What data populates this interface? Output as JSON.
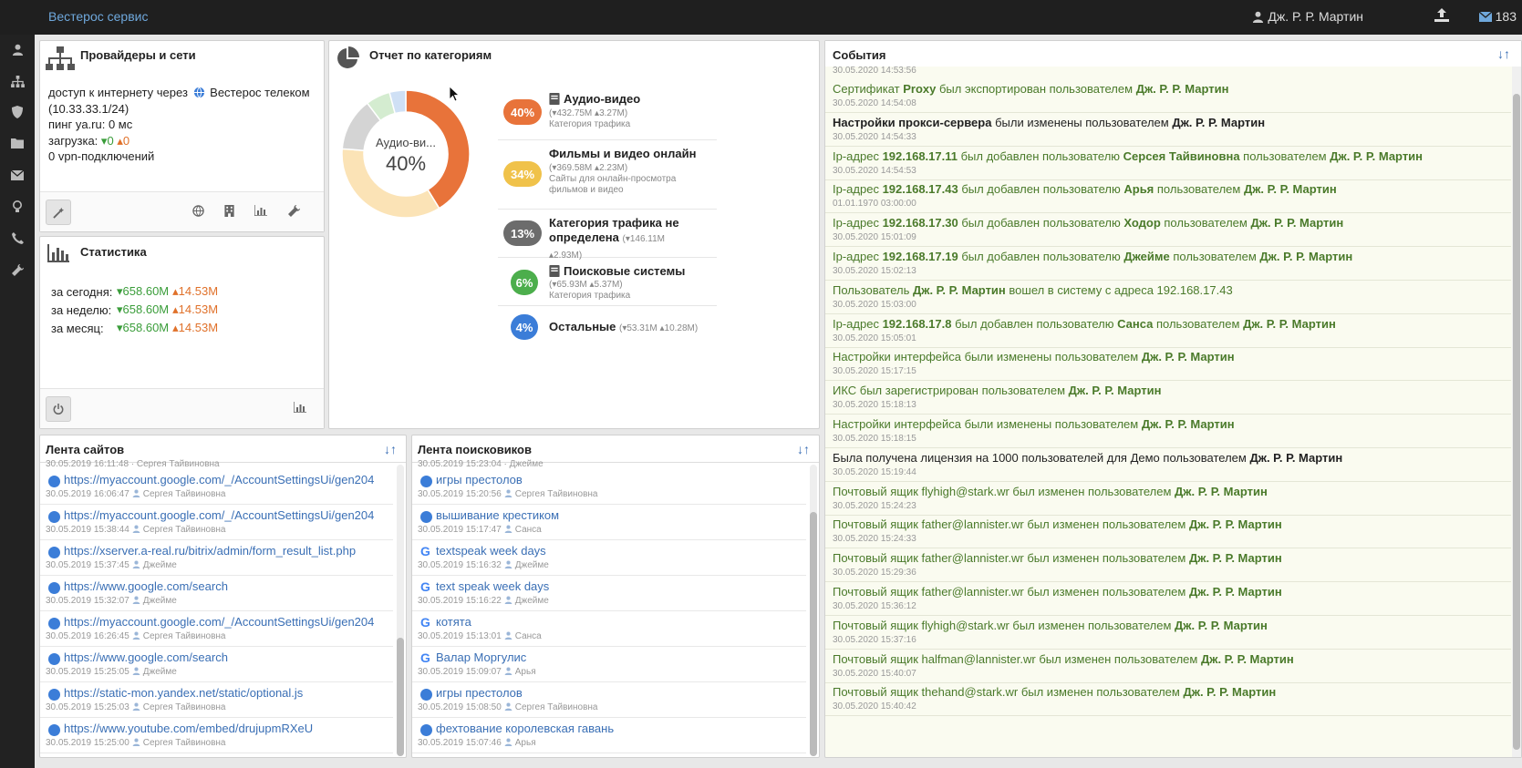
{
  "header": {
    "brand": "Вестерос сервис",
    "user": "Дж. Р. Р. Мартин",
    "mail_count": "183"
  },
  "providers": {
    "title": "Провайдеры и сети",
    "line1_prefix": "доступ к интернету через",
    "provider": "Вестерос телеком",
    "subnet": "(10.33.33.1/24)",
    "ping": "пинг ya.ru: 0 мс",
    "load_label": "загрузка:",
    "load_down": "0",
    "load_up": "0",
    "vpn": "0 vpn-подключений"
  },
  "stats": {
    "title": "Статистика",
    "rows": [
      {
        "label": "за сегодня:",
        "down": "658.60M",
        "up": "14.53M"
      },
      {
        "label": "за неделю:",
        "down": "658.60M",
        "up": "14.53M"
      },
      {
        "label": "за месяц:",
        "down": "658.60M",
        "up": "14.53M"
      }
    ]
  },
  "categories": {
    "title": "Отчет по категориям",
    "donut_label": "Аудио-ви...",
    "donut_value": "40%",
    "chart_data": {
      "type": "pie",
      "values": [
        40,
        34,
        13,
        6,
        4
      ],
      "colors": [
        "#e8733a",
        "#fbe3b6",
        "#d4d4d4",
        "#d4ecd0",
        "#cfe0f5"
      ]
    },
    "items": [
      {
        "pct": "40%",
        "color": "#e8733a",
        "name": "Аудио-видео",
        "stats": "(▾432.75M ▴3.27M)",
        "desc": "Категория трафика"
      },
      {
        "pct": "34%",
        "color": "#f0c24a",
        "name": "Фильмы и видео онлайн",
        "stats": "(▾369.58M ▴2.23M)",
        "desc": "Сайты для онлайн-просмотра фильмов и видео"
      },
      {
        "pct": "13%",
        "color": "#6c6c6c",
        "name": "Категория трафика не определена",
        "stats": "(▾146.11M ▴2.93M)",
        "desc": ""
      },
      {
        "pct": "6%",
        "color": "#4cae4c",
        "name": "Поисковые системы",
        "stats": "(▾65.93M ▴5.37M)",
        "desc": "Категория трафика"
      },
      {
        "pct": "4%",
        "color": "#3b7dd8",
        "name": "Остальные",
        "stats": "(▾53.31M ▴10.28M)",
        "desc": ""
      }
    ]
  },
  "sites": {
    "title": "Лента сайтов",
    "partial_meta": "30.05.2019 16:11:48 · Сергея Тайвиновна",
    "items": [
      {
        "url": "https://myaccount.google.com/_/AccountSettingsUi/gen204",
        "time": "30.05.2019 16:06:47",
        "user": "Сергея Тайвиновна"
      },
      {
        "url": "https://myaccount.google.com/_/AccountSettingsUi/gen204",
        "time": "30.05.2019 15:38:44",
        "user": "Сергея Тайвиновна"
      },
      {
        "url": "https://xserver.a-real.ru/bitrix/admin/form_result_list.php",
        "time": "30.05.2019 15:37:45",
        "user": "Джейме"
      },
      {
        "url": "https://www.google.com/search",
        "time": "30.05.2019 15:32:07",
        "user": "Джейме"
      },
      {
        "url": "https://myaccount.google.com/_/AccountSettingsUi/gen204",
        "time": "30.05.2019 16:26:45",
        "user": "Сергея Тайвиновна"
      },
      {
        "url": "https://www.google.com/search",
        "time": "30.05.2019 15:25:05",
        "user": "Джейме"
      },
      {
        "url": "https://static-mon.yandex.net/static/optional.js",
        "time": "30.05.2019 15:25:03",
        "user": "Сергея Тайвиновна"
      },
      {
        "url": "https://www.youtube.com/embed/drujupmRXeU",
        "time": "30.05.2019 15:25:00",
        "user": "Сергея Тайвиновна"
      }
    ]
  },
  "searches": {
    "title": "Лента поисковиков",
    "partial_meta": "30.05.2019 15:23:04 · Джейме",
    "items": [
      {
        "q": "игры престолов",
        "engine": "dot",
        "time": "30.05.2019 15:20:56",
        "user": "Сергея Тайвиновна"
      },
      {
        "q": "вышивание крестиком",
        "engine": "dot",
        "time": "30.05.2019 15:17:47",
        "user": "Санса"
      },
      {
        "q": "textspeak week days",
        "engine": "google",
        "time": "30.05.2019 15:16:32",
        "user": "Джейме"
      },
      {
        "q": "text speak week days",
        "engine": "google",
        "time": "30.05.2019 15:16:22",
        "user": "Джейме"
      },
      {
        "q": "котята",
        "engine": "google",
        "time": "30.05.2019 15:13:01",
        "user": "Санса"
      },
      {
        "q": "Валар Моргулис",
        "engine": "google",
        "time": "30.05.2019 15:09:07",
        "user": "Арья"
      },
      {
        "q": "игры престолов",
        "engine": "dot",
        "time": "30.05.2019 15:08:50",
        "user": "Сергея Тайвиновна"
      },
      {
        "q": "фехтование королевская гавань",
        "engine": "dot",
        "time": "30.05.2019 15:07:46",
        "user": "Арья"
      }
    ]
  },
  "events": {
    "title": "События",
    "first_time": "30.05.2020 14:53:56",
    "items": [
      {
        "style": "green",
        "html": "Сертификат <b>Proxy</b> был экспортирован пользователем <b>Дж. Р. Р. Мартин</b>",
        "time": "30.05.2020 14:54:08"
      },
      {
        "style": "dark",
        "html": "<b>Настройки прокси-сервера</b> были изменены пользователем <b>Дж. Р. Р. Мартин</b>",
        "time": "30.05.2020 14:54:33"
      },
      {
        "style": "green",
        "html": "Ip-адрес <b>192.168.17.11</b> был добавлен пользователю <b>Серсея Тайвиновна</b> пользователем <b>Дж. Р. Р. Мартин</b>",
        "time": "30.05.2020 14:54:53"
      },
      {
        "style": "green",
        "html": "Ip-адрес <b>192.168.17.43</b> был добавлен пользователю <b>Арья</b> пользователем <b>Дж. Р. Р. Мартин</b>",
        "time": "01.01.1970 03:00:00"
      },
      {
        "style": "green",
        "html": "Ip-адрес <b>192.168.17.30</b> был добавлен пользователю <b>Ходор</b> пользователем <b>Дж. Р. Р. Мартин</b>",
        "time": "30.05.2020 15:01:09"
      },
      {
        "style": "green",
        "html": "Ip-адрес <b>192.168.17.19</b> был добавлен пользователю <b>Джейме</b> пользователем <b>Дж. Р. Р. Мартин</b>",
        "time": "30.05.2020 15:02:13"
      },
      {
        "style": "green",
        "html": "Пользователь <b>Дж. Р. Р. Мартин</b> вошел в систему с адреса 192.168.17.43",
        "time": "30.05.2020 15:03:00"
      },
      {
        "style": "green",
        "html": "Ip-адрес <b>192.168.17.8</b> был добавлен пользователю <b>Санса</b> пользователем <b>Дж. Р. Р. Мартин</b>",
        "time": "30.05.2020 15:05:01"
      },
      {
        "style": "green",
        "html": "Настройки интерфейса были изменены пользователем <b>Дж. Р. Р. Мартин</b>",
        "time": "30.05.2020 15:17:15"
      },
      {
        "style": "green",
        "html": "ИКС был зарегистрирован пользователем <b>Дж. Р. Р. Мартин</b>",
        "time": "30.05.2020 15:18:13"
      },
      {
        "style": "green",
        "html": "Настройки интерфейса были изменены пользователем <b>Дж. Р. Р. Мартин</b>",
        "time": "30.05.2020 15:18:15"
      },
      {
        "style": "dark",
        "html": "Была получена лицензия на 1000 пользователей для Демо пользователем <b>Дж. Р. Р. Мартин</b>",
        "time": "30.05.2020 15:19:44"
      },
      {
        "style": "green",
        "html": "Почтовый ящик flyhigh@stark.wr был изменен пользователем <b>Дж. Р. Р. Мартин</b>",
        "time": "30.05.2020 15:24:23"
      },
      {
        "style": "green",
        "html": "Почтовый ящик father@lannister.wr был изменен пользователем <b>Дж. Р. Р. Мартин</b>",
        "time": "30.05.2020 15:24:33"
      },
      {
        "style": "green",
        "html": "Почтовый ящик father@lannister.wr был изменен пользователем <b>Дж. Р. Р. Мартин</b>",
        "time": "30.05.2020 15:29:36"
      },
      {
        "style": "green",
        "html": "Почтовый ящик father@lannister.wr был изменен пользователем <b>Дж. Р. Р. Мартин</b>",
        "time": "30.05.2020 15:36:12"
      },
      {
        "style": "green",
        "html": "Почтовый ящик flyhigh@stark.wr был изменен пользователем <b>Дж. Р. Р. Мартин</b>",
        "time": "30.05.2020 15:37:16"
      },
      {
        "style": "green",
        "html": "Почтовый ящик halfman@lannister.wr был изменен пользователем <b>Дж. Р. Р. Мартин</b>",
        "time": "30.05.2020 15:40:07"
      },
      {
        "style": "green",
        "html": "Почтовый ящик thehand@stark.wr был изменен пользователем <b>Дж. Р. Р. Мартин</b>",
        "time": "30.05.2020 15:40:42"
      }
    ]
  }
}
